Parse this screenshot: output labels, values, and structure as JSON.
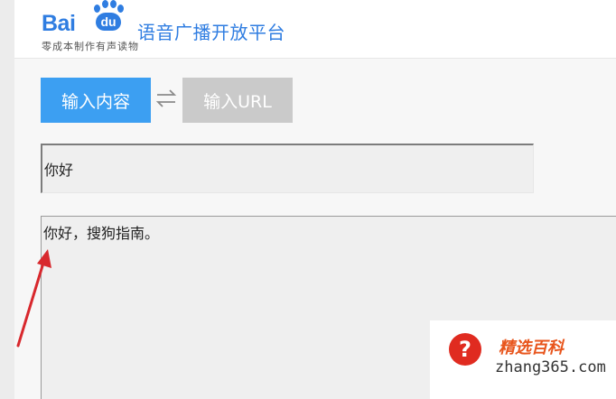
{
  "header": {
    "logo_text": "Bai",
    "logo_du": "du",
    "platform_title": "语音广播开放平台",
    "slogan": "零成本制作有声读物"
  },
  "tabs": {
    "input_content": "输入内容",
    "input_url": "输入URL"
  },
  "input_field": {
    "value": "你好"
  },
  "text_area": {
    "value": "你好，搜狗指南。"
  },
  "watermark": {
    "name": "精选百科",
    "domain": "zhang365.com",
    "badge": "?"
  },
  "colors": {
    "brand_blue": "#2f7de1",
    "active_tab": "#3c9ff2",
    "inactive_tab": "#cacaca",
    "arrow_red": "#d8282d"
  },
  "icons": [
    "paw-logo-icon",
    "swap-arrows-icon",
    "red-arrow-annotation",
    "question-badge-icon"
  ]
}
